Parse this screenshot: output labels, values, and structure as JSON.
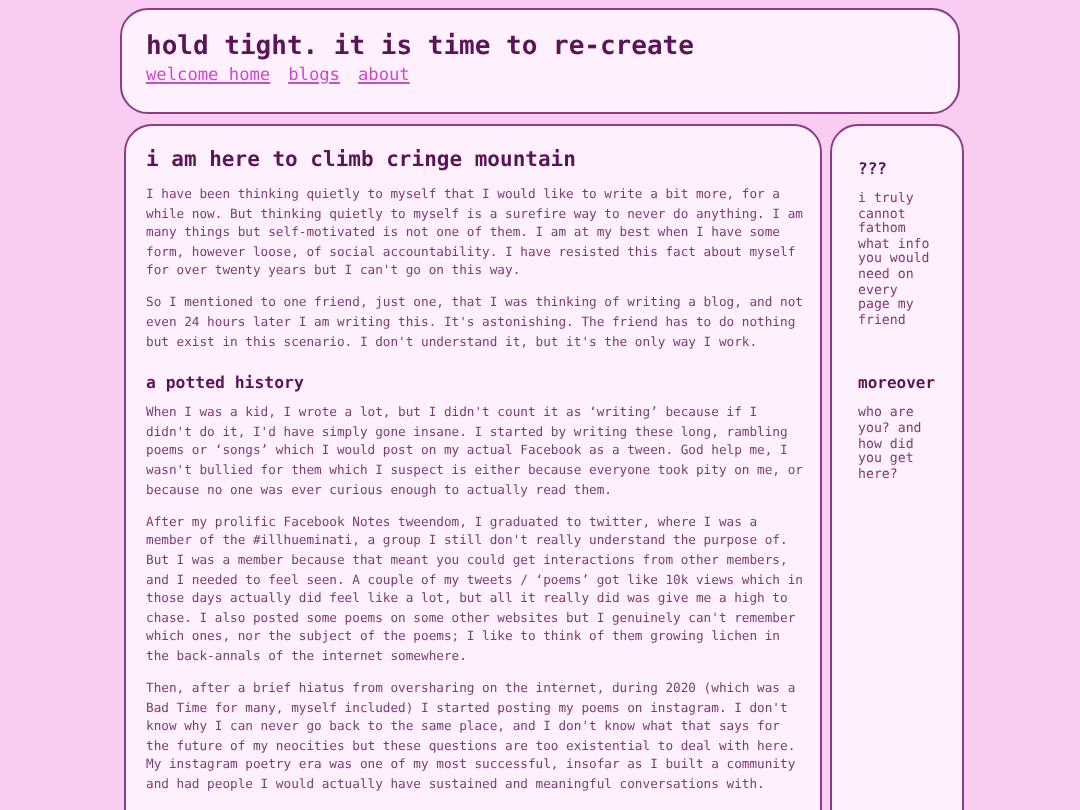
{
  "header": {
    "title": "hold tight. it is time to re-create",
    "nav": [
      {
        "label": "welcome home"
      },
      {
        "label": "blogs"
      },
      {
        "label": "about"
      }
    ]
  },
  "main": {
    "title": "i am here to climb cringe mountain",
    "sections": [
      {
        "paragraphs": [
          "I have been thinking quietly to myself that I would like to write a bit more, for a while now. But thinking quietly to myself is a surefire way to never do anything. I am many things but self-motivated is not one of them. I am at my best when I have some form, however loose, of social accountability. I have resisted this fact about myself for over twenty years but I can't go on this way.",
          "So I mentioned to one friend, just one, that I was thinking of writing a blog, and not even 24 hours later I am writing this. It's astonishing. The friend has to do nothing but exist in this scenario. I don't understand it, but it's the only way I work."
        ]
      },
      {
        "heading": "a potted history",
        "paragraphs": [
          "When I was a kid, I wrote a lot, but I didn't count it as ‘writing’ because if I didn't do it, I'd have simply gone insane. I started by writing these long, rambling poems or ‘songs’ which I would post on my actual Facebook as a tween. God help me, I wasn't bullied for them which I suspect is either because everyone took pity on me, or because no one was ever curious enough to actually read them.",
          "After my prolific Facebook Notes tweendom, I graduated to twitter, where I was a member of the #illhueminati, a group I still don't really understand the purpose of. But I was a member because that meant you could get interactions from other members, and I needed to feel seen. A couple of my tweets / ‘poems’ got like 10k views which in those days actually did feel like a lot, but all it really did was give me a high to chase. I also posted some poems on some other websites but I genuinely can't remember which ones, nor the subject of the poems; I like to think of them growing lichen in the back-annals of the internet somewhere.",
          "Then, after a brief hiatus from oversharing on the internet, during 2020 (which was a Bad Time for many, myself included) I started posting my poems on instagram. I don't know why I can never go back to the same place, and I don't know what that says for the future of my neocities but these questions are too existential to deal with here. My instagram poetry era was one of my most successful, insofar as I built a community and had people I would actually have sustained and meaningful conversations with."
        ]
      }
    ]
  },
  "sidebar": {
    "sections": [
      {
        "heading": "???",
        "text": "i truly cannot fathom what info you would need on every page my friend"
      },
      {
        "heading": "moreover",
        "text": "who are you? and how did you get here?"
      }
    ]
  }
}
